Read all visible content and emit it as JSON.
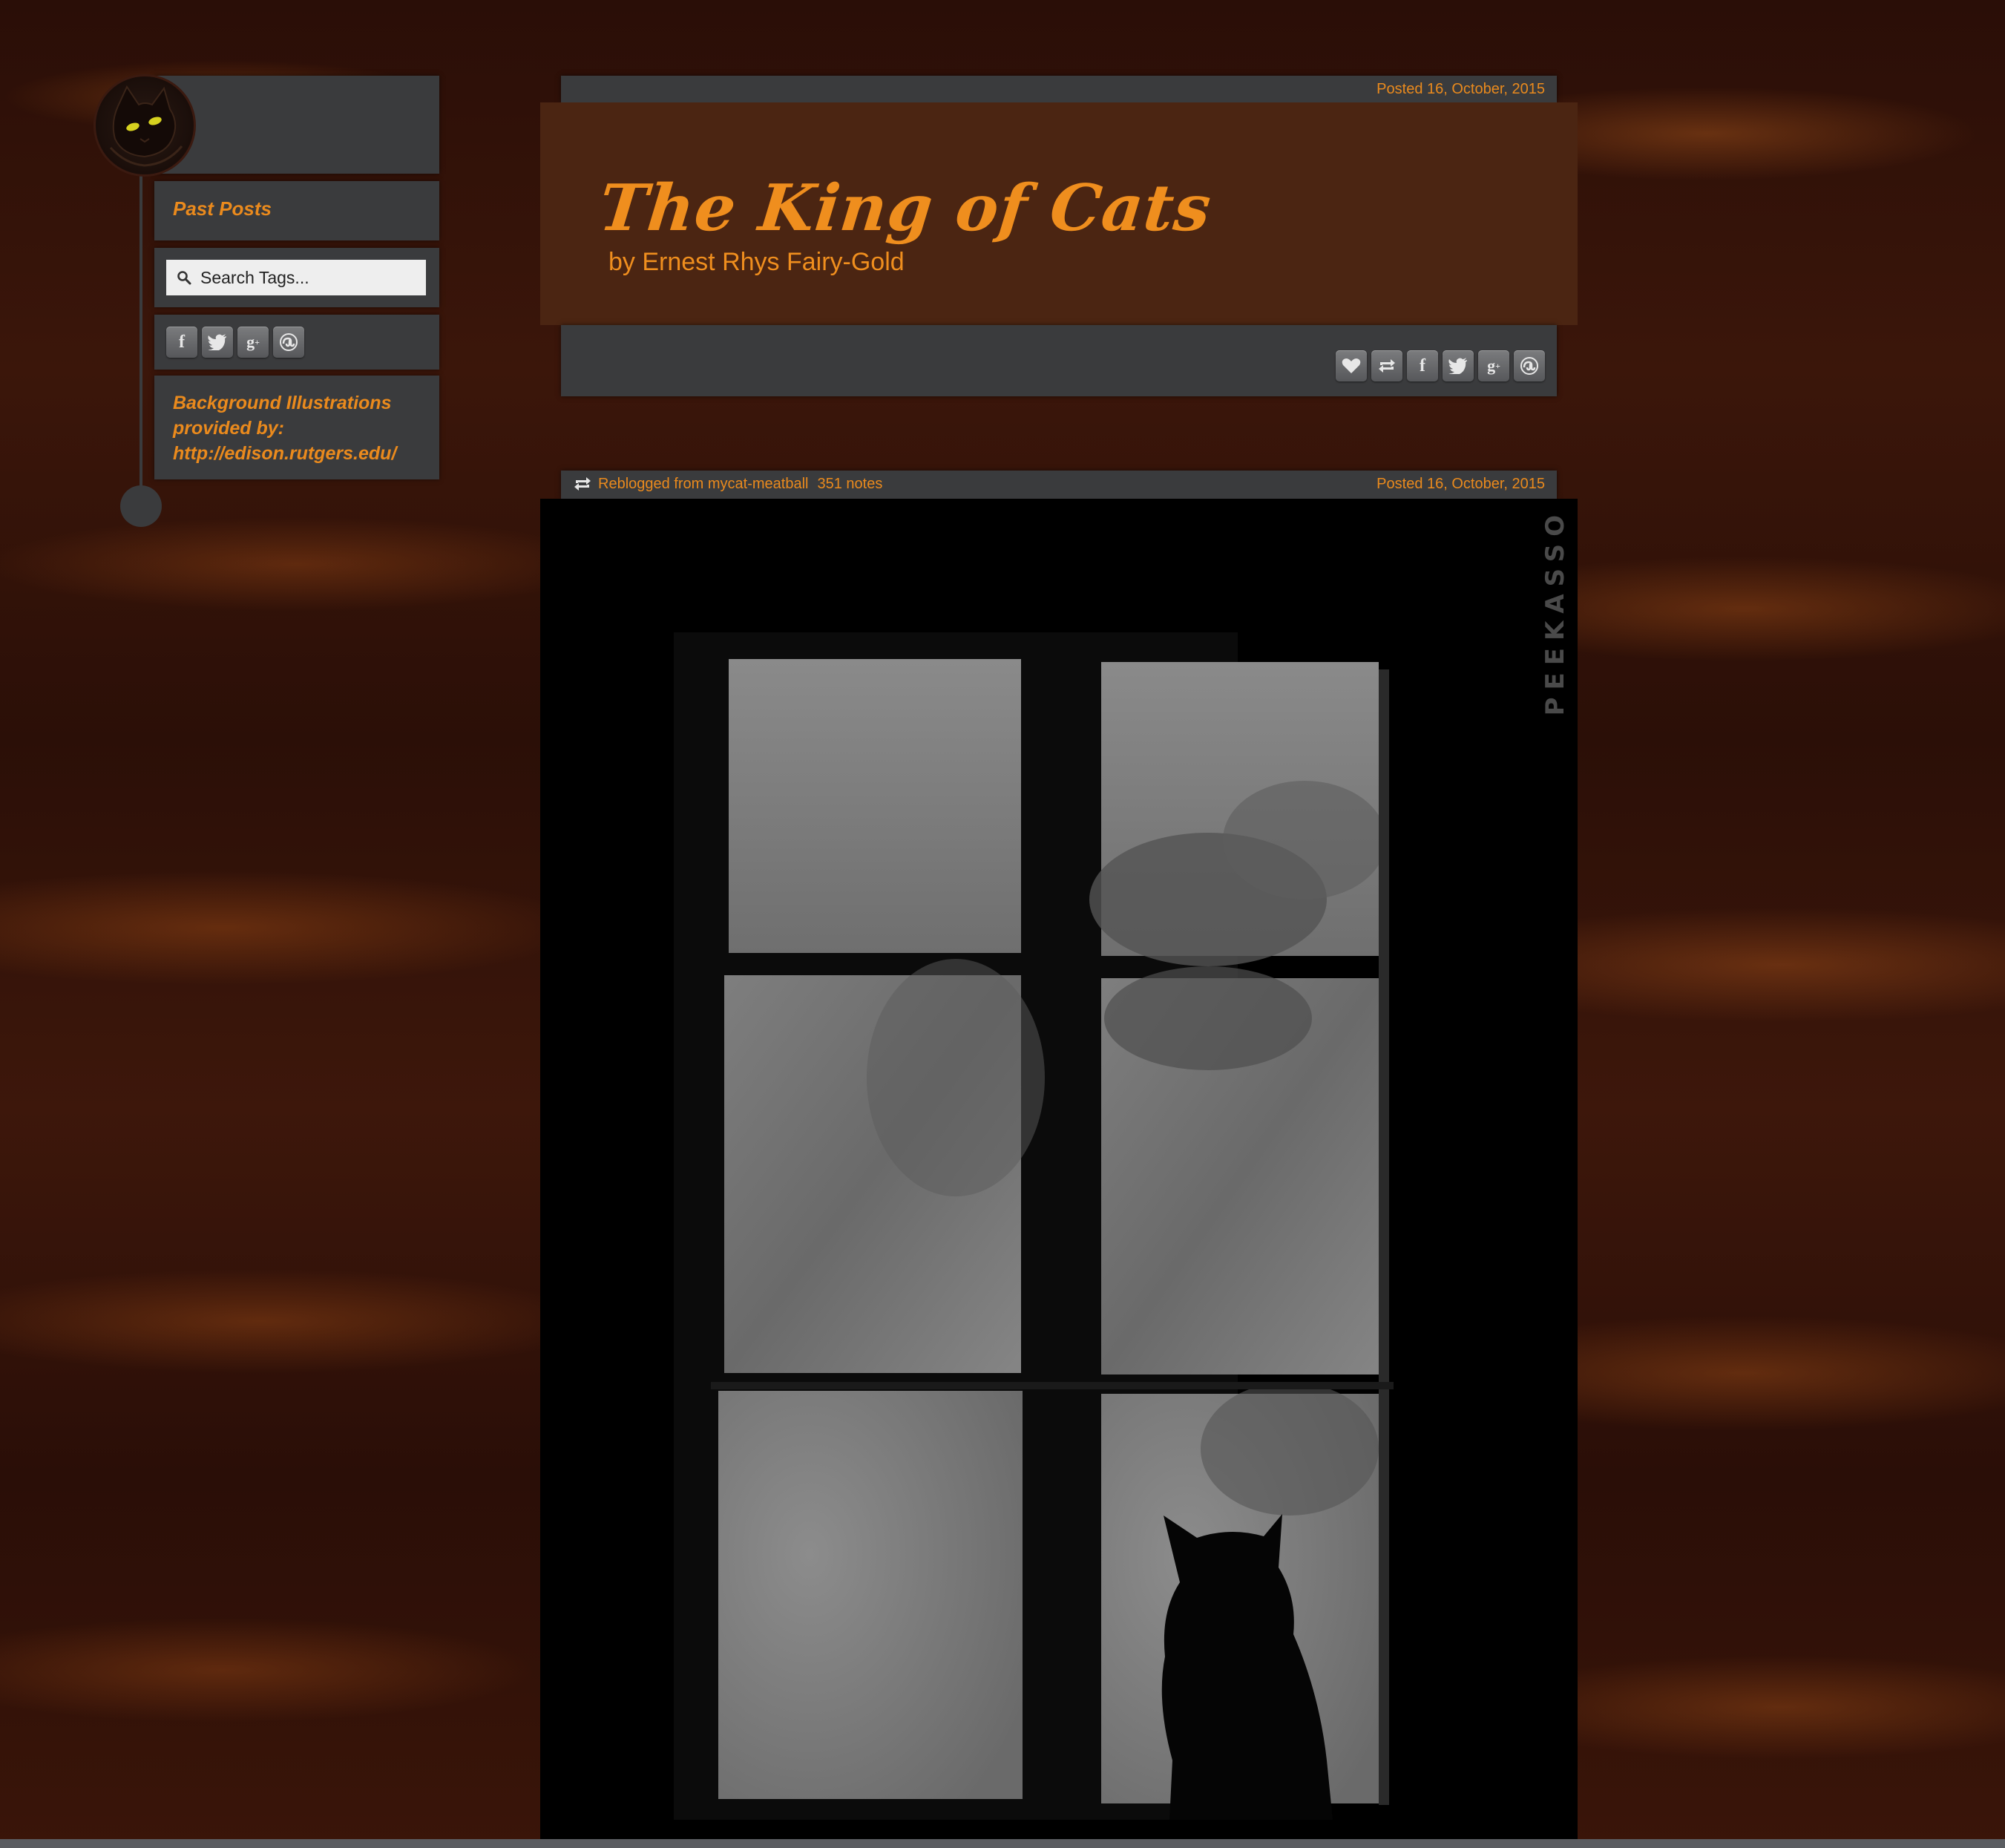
{
  "sidebar": {
    "past_posts": "Past Posts",
    "search_placeholder": "Search Tags...",
    "social": [
      "facebook-icon",
      "twitter-icon",
      "google-plus-icon",
      "stumbleupon-icon"
    ],
    "credits": "Background Illustrations provided by: http://edison.rutgers.edu/"
  },
  "posts": [
    {
      "date": "Posted 16, October, 2015",
      "title": "The King of Cats",
      "subtitle": "by Ernest Rhys Fairy-Gold",
      "actions": [
        "like-icon",
        "reblog-icon",
        "facebook-icon",
        "twitter-icon",
        "google-plus-icon",
        "stumbleupon-icon"
      ]
    },
    {
      "date": "Posted 16, October, 2015",
      "reblogged_from": "Reblogged from mycat-meatball",
      "notes": "351 notes",
      "photo_watermark": "PEEKASSO"
    }
  ],
  "colors": {
    "accent": "#ea8a1d",
    "panel": "#3a3b3d",
    "banner": "#4b2512"
  }
}
